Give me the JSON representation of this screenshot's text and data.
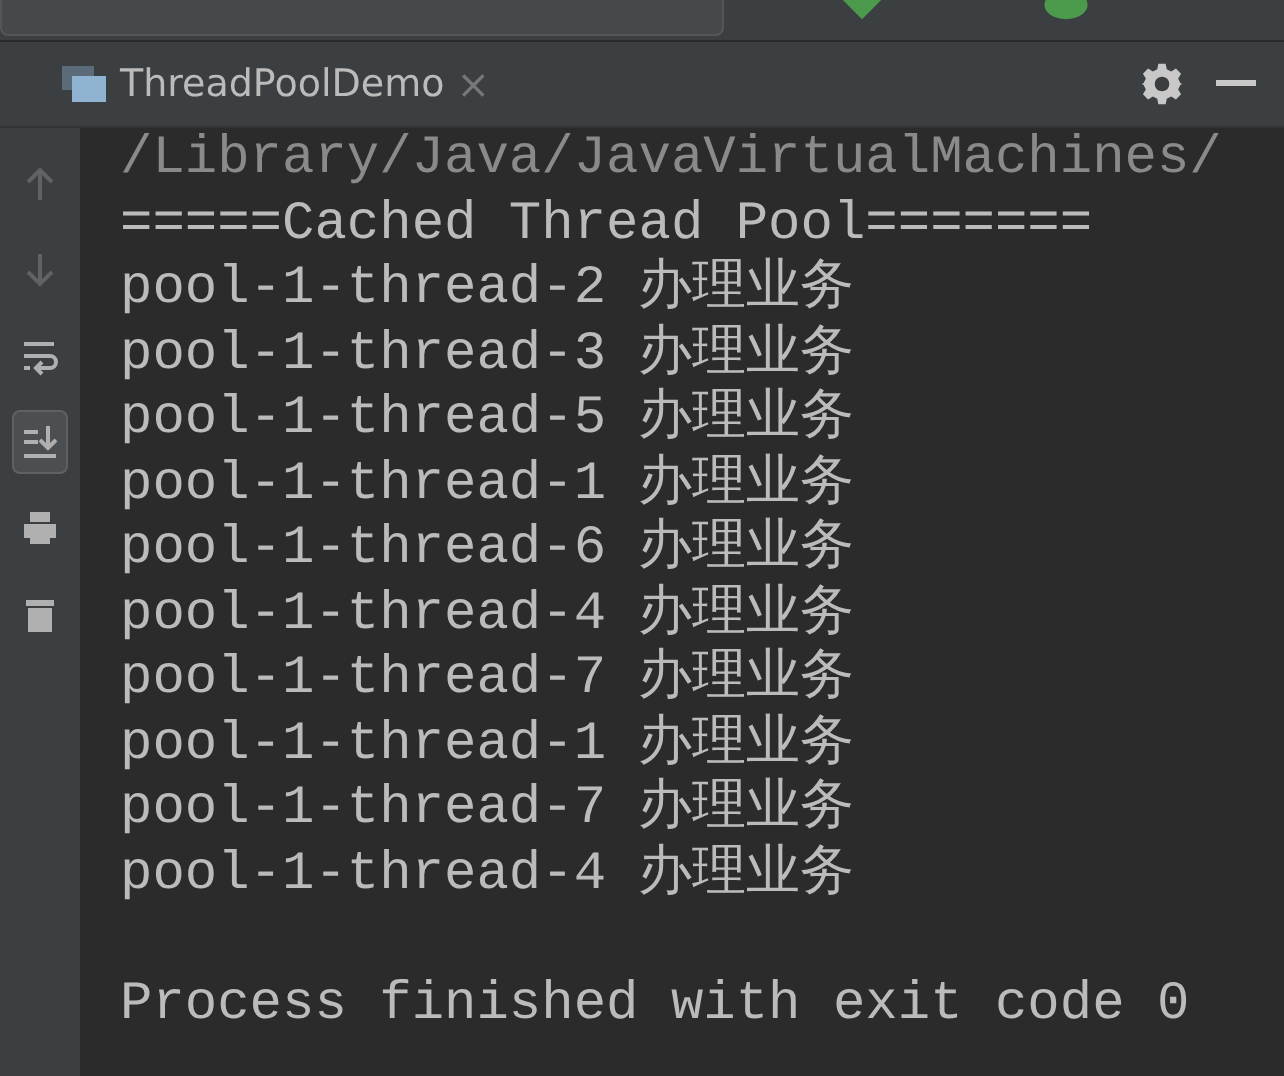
{
  "run_tab": {
    "title": "ThreadPoolDemo",
    "close": "×"
  },
  "toolbar": [
    {
      "kind": "up",
      "disabled": true,
      "on": false
    },
    {
      "kind": "down",
      "disabled": true,
      "on": false
    },
    {
      "kind": "wrap",
      "disabled": false,
      "on": false
    },
    {
      "kind": "scroll",
      "disabled": false,
      "on": true
    },
    {
      "kind": "print",
      "disabled": false,
      "on": false
    },
    {
      "kind": "trash",
      "disabled": false,
      "on": false
    }
  ],
  "console": {
    "lines": [
      {
        "kind": "path",
        "text": "/Library/Java/JavaVirtualMachines/"
      },
      {
        "kind": "out",
        "text": "=====Cached Thread Pool======="
      },
      {
        "kind": "out",
        "text": "pool-1-thread-2 办理业务"
      },
      {
        "kind": "out",
        "text": "pool-1-thread-3 办理业务"
      },
      {
        "kind": "out",
        "text": "pool-1-thread-5 办理业务"
      },
      {
        "kind": "out",
        "text": "pool-1-thread-1 办理业务"
      },
      {
        "kind": "out",
        "text": "pool-1-thread-6 办理业务"
      },
      {
        "kind": "out",
        "text": "pool-1-thread-4 办理业务"
      },
      {
        "kind": "out",
        "text": "pool-1-thread-7 办理业务"
      },
      {
        "kind": "out",
        "text": "pool-1-thread-1 办理业务"
      },
      {
        "kind": "out",
        "text": "pool-1-thread-7 办理业务"
      },
      {
        "kind": "out",
        "text": "pool-1-thread-4 办理业务"
      },
      {
        "kind": "blank"
      },
      {
        "kind": "out",
        "text": "Process finished with exit code 0"
      }
    ]
  }
}
